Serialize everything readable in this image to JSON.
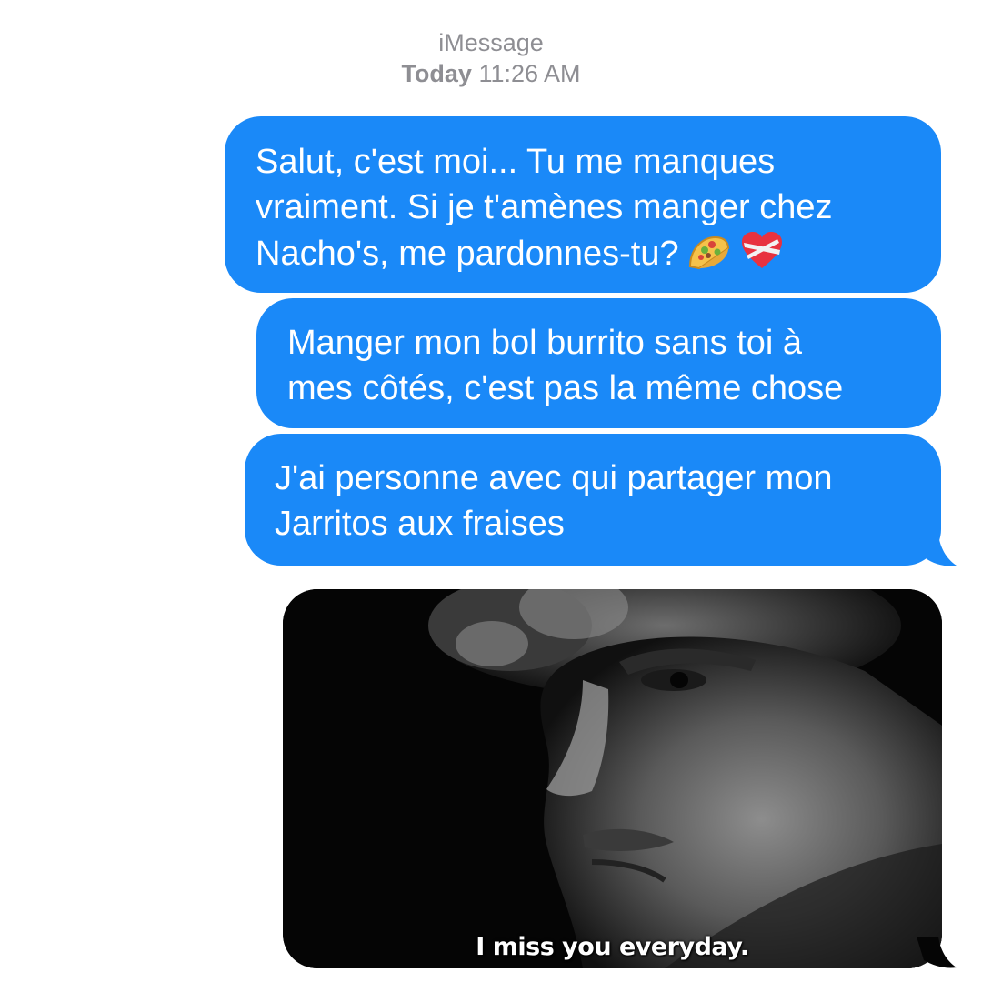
{
  "header": {
    "service": "iMessage",
    "day": "Today",
    "time": "11:26 AM"
  },
  "messages": [
    {
      "text": "Salut, c'est moi... Tu me manques\nvraiment. Si je t'amènes manger chez\nNacho's, me pardonnes-tu?",
      "emojis": [
        "taco-emoji",
        "heart-with-ribbon-emoji"
      ]
    },
    {
      "text": "Manger mon bol burrito sans toi à\nmes côtés, c'est pas la même chose"
    },
    {
      "text": "J'ai personne avec qui partager mon\nJarritos aux fraises"
    }
  ],
  "photo_message": {
    "caption": "I miss you everyday.",
    "icon": "sad-man-photo"
  },
  "colors": {
    "bubble": "#1a89f8",
    "header_text": "#8e8e93",
    "background": "#ffffff"
  }
}
